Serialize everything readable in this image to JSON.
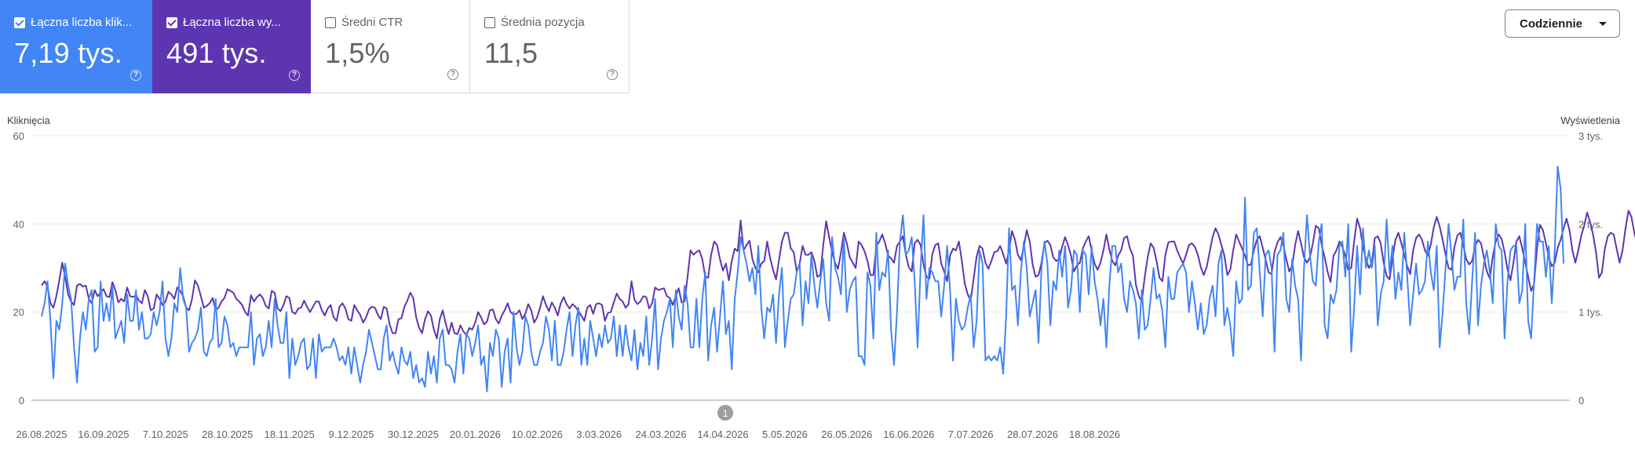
{
  "metrics": [
    {
      "label": "Łączna liczba klik...",
      "value": "7,19 tys.",
      "checked": true,
      "color": "#4285f4"
    },
    {
      "label": "Łączna liczba wy...",
      "value": "491 tys.",
      "checked": true,
      "color": "#5e35b1"
    },
    {
      "label": "Średni CTR",
      "value": "1,5%",
      "checked": false
    },
    {
      "label": "Średnia pozycja",
      "value": "11,5",
      "checked": false
    }
  ],
  "help_icon": "help-circle-icon",
  "period_dropdown": {
    "label": "Codziennie",
    "icon": "caret-down-icon"
  },
  "chart_data": {
    "type": "line",
    "left_axis_label": "Kliknięcia",
    "right_axis_label": "Wyświetlenia",
    "left_ticks": [
      "0",
      "20",
      "40",
      "60"
    ],
    "right_ticks": [
      "0",
      "1 tys.",
      "2 tys.",
      "3 tys."
    ],
    "left_ylim": [
      0,
      60
    ],
    "right_ylim": [
      0,
      3000
    ],
    "x_tick_labels": [
      "26.08.2025",
      "16.09.2025",
      "7.10.2025",
      "28.10.2025",
      "18.11.2025",
      "9.12.2025",
      "30.12.2025",
      "20.01.2026",
      "10.02.2026",
      "3.03.2026",
      "24.03.2026",
      "14.04.2026",
      "5.05.2026",
      "26.05.2026",
      "16.06.2026",
      "7.07.2026",
      "28.07.2026",
      "18.08.2026"
    ],
    "days_between_ticks": 21,
    "annotation": {
      "label": "1",
      "date": "14.04.2026"
    },
    "grid": true,
    "series": [
      {
        "name": "Kliknięcia",
        "axis": "left",
        "color": "#4285f4",
        "values": [
          19,
          22,
          27,
          18,
          5,
          18,
          16,
          22,
          31,
          26,
          23,
          12,
          4,
          14,
          20,
          16,
          23,
          25,
          11,
          12,
          27,
          18,
          22,
          18,
          26,
          14,
          16,
          18,
          13,
          24,
          18,
          18,
          25,
          16,
          20,
          14,
          14,
          15,
          20,
          17,
          20,
          27,
          14,
          10,
          14,
          22,
          20,
          30,
          23,
          21,
          11,
          13,
          14,
          16,
          21,
          11,
          10,
          13,
          14,
          23,
          12,
          13,
          19,
          17,
          12,
          13,
          10,
          12,
          12,
          12,
          12,
          20,
          8,
          14,
          15,
          10,
          12,
          18,
          12,
          23,
          17,
          13,
          13,
          20,
          5,
          14,
          8,
          10,
          13,
          14,
          7,
          8,
          14,
          5,
          15,
          11,
          12,
          12,
          12,
          14,
          12,
          9,
          10,
          8,
          12,
          6,
          12,
          8,
          4,
          8,
          11,
          16,
          13,
          10,
          7,
          7,
          14,
          17,
          9,
          11,
          8,
          6,
          12,
          9,
          8,
          11,
          5,
          8,
          4,
          5,
          3,
          11,
          6,
          10,
          4,
          14,
          16,
          8,
          8,
          7,
          4,
          11,
          15,
          6,
          15,
          14,
          10,
          13,
          17,
          8,
          10,
          2,
          13,
          10,
          16,
          14,
          3,
          11,
          14,
          4,
          20,
          12,
          8,
          11,
          19,
          17,
          11,
          8,
          8,
          11,
          13,
          19,
          16,
          9,
          18,
          8,
          8,
          11,
          16,
          20,
          10,
          17,
          21,
          8,
          14,
          8,
          18,
          14,
          10,
          15,
          12,
          17,
          13,
          14,
          19,
          10,
          17,
          10,
          17,
          12,
          9,
          16,
          7,
          13,
          10,
          19,
          8,
          14,
          23,
          7,
          14,
          18,
          20,
          23,
          12,
          25,
          19,
          16,
          26,
          22,
          12,
          12,
          23,
          12,
          23,
          29,
          9,
          17,
          21,
          11,
          19,
          27,
          15,
          18,
          7,
          23,
          29,
          37,
          34,
          31,
          27,
          30,
          24,
          35,
          21,
          14,
          21,
          20,
          24,
          13,
          24,
          30,
          12,
          18,
          23,
          24,
          29,
          31,
          17,
          27,
          22,
          33,
          26,
          21,
          27,
          32,
          22,
          18,
          37,
          30,
          28,
          24,
          37,
          20,
          25,
          27,
          28,
          10,
          10,
          8,
          29,
          26,
          14,
          38,
          25,
          29,
          28,
          34,
          16,
          8,
          20,
          36,
          42,
          33,
          34,
          37,
          27,
          12,
          30,
          42,
          23,
          30,
          29,
          27,
          27,
          19,
          26,
          35,
          25,
          9,
          23,
          18,
          16,
          17,
          21,
          24,
          12,
          18,
          34,
          31,
          9,
          10,
          9,
          10,
          9,
          12,
          6,
          19,
          39,
          25,
          26,
          17,
          29,
          36,
          30,
          19,
          22,
          25,
          13,
          30,
          36,
          31,
          17,
          27,
          25,
          34,
          28,
          35,
          21,
          25,
          34,
          33,
          20,
          34,
          33,
          24,
          35,
          27,
          23,
          17,
          23,
          12,
          26,
          35,
          35,
          29,
          31,
          23,
          20,
          27,
          25,
          22,
          14,
          25,
          16,
          17,
          23,
          30,
          23,
          24,
          20,
          12,
          28,
          23,
          23,
          29,
          30,
          31,
          29,
          20,
          27,
          22,
          16,
          22,
          15,
          17,
          23,
          26,
          19,
          31,
          34,
          17,
          21,
          17,
          10,
          27,
          22,
          23,
          46,
          25,
          26,
          38,
          39,
          29,
          19,
          33,
          34,
          30,
          11,
          33,
          34,
          38,
          23,
          20,
          32,
          26,
          23,
          9,
          30,
          42,
          33,
          27,
          26,
          36,
          40,
          17,
          14,
          24,
          22,
          25,
          35,
          36,
          28,
          40,
          11,
          21,
          35,
          24,
          39,
          30,
          34,
          30,
          35,
          17,
          24,
          27,
          41,
          29,
          35,
          23,
          29,
          25,
          38,
          28,
          17,
          24,
          31,
          24,
          25,
          27,
          36,
          29,
          25,
          35,
          12,
          20,
          30,
          40,
          33,
          25,
          28,
          28,
          41,
          22,
          15,
          27,
          38,
          17,
          26,
          31,
          34,
          29,
          22,
          40,
          35,
          34,
          14,
          27,
          34,
          35,
          35,
          22,
          25,
          40,
          18,
          14,
          27,
          40,
          36,
          36,
          28,
          35,
          22,
          34,
          53,
          48,
          31
        ]
      },
      {
        "name": "Wyświetlenia",
        "axis": "right",
        "color": "#5e35b1",
        "values": [
          1300,
          1350,
          1290,
          1100,
          1050,
          1180,
          1360,
          1560,
          1400,
          1200,
          1120,
          1080,
          1300,
          1320,
          1290,
          1300,
          1150,
          1100,
          1250,
          1180,
          1220,
          1260,
          1180,
          1170,
          1340,
          1250,
          1110,
          1150,
          1120,
          1280,
          1180,
          1170,
          1190,
          1130,
          1100,
          1250,
          1180,
          1020,
          1040,
          1200,
          1150,
          1080,
          1120,
          1230,
          1200,
          1150,
          1280,
          1240,
          1180,
          1050,
          1020,
          1150,
          1360,
          1300,
          1180,
          1050,
          1070,
          1100,
          1160,
          1020,
          1050,
          1120,
          1160,
          1260,
          1240,
          1220,
          1150,
          1120,
          1080,
          1000,
          960,
          1190,
          1120,
          1170,
          1200,
          1160,
          1070,
          1040,
          1240,
          1220,
          1040,
          1010,
          1080,
          1180,
          1160,
          1000,
          980,
          1040,
          1050,
          1130,
          1060,
          1000,
          1060,
          1120,
          1120,
          1020,
          960,
          1040,
          1080,
          940,
          900,
          1060,
          1100,
          1040,
          920,
          900,
          1080,
          1020,
          970,
          880,
          940,
          1030,
          1060,
          1050,
          970,
          920,
          1060,
          1040,
          860,
          760,
          760,
          920,
          930,
          1060,
          1130,
          1220,
          1160,
          940,
          820,
          760,
          920,
          1010,
          960,
          800,
          700,
          920,
          1020,
          870,
          750,
          880,
          760,
          750,
          850,
          780,
          740,
          820,
          800,
          880,
          1000,
          940,
          860,
          890,
          1020,
          1030,
          920,
          870,
          960,
          1020,
          1100,
          1000,
          970,
          980,
          1020,
          920,
          980,
          1090,
          1020,
          880,
          940,
          1050,
          1180,
          1080,
          1010,
          1110,
          1050,
          960,
          1100,
          1170,
          1090,
          1040,
          1090,
          1060,
          1010,
          960,
          900,
          1050,
          1080,
          980,
          1090,
          1100,
          1080,
          900,
          990,
          1000,
          1110,
          1210,
          1150,
          1120,
          1050,
          1090,
          1350,
          1140,
          1090,
          1120,
          1180,
          1170,
          1040,
          1100,
          1280,
          1250,
          1260,
          1270,
          1180,
          1160,
          1080,
          1180,
          1270,
          1110,
          1120,
          1400,
          1700,
          1650,
          1680,
          1700,
          1600,
          1400,
          1390,
          1650,
          1800,
          1760,
          1600,
          1470,
          1550,
          1360,
          1580,
          1720,
          1690,
          2040,
          1700,
          1760,
          1810,
          1600,
          1500,
          1450,
          1550,
          1580,
          1800,
          1610,
          1480,
          1370,
          1590,
          1800,
          1900,
          1900,
          1720,
          1680,
          1460,
          1550,
          1750,
          1650,
          1650,
          1680,
          1580,
          1400,
          1420,
          1760,
          2030,
          1850,
          1680,
          1560,
          1490,
          1670,
          1900,
          1780,
          1620,
          1560,
          1500,
          1800,
          1760,
          1690,
          1580,
          1420,
          1420,
          1750,
          1800,
          1880,
          1780,
          1640,
          1610,
          1560,
          1750,
          1800,
          1860,
          1650,
          1510,
          1460,
          1780,
          1820,
          1760,
          1540,
          1400,
          1380,
          1660,
          1760,
          1780,
          1550,
          1460,
          1350,
          1640,
          1720,
          1700,
          1800,
          1580,
          1320,
          1200,
          1130,
          1380,
          1630,
          1750,
          1720,
          1560,
          1490,
          1580,
          1680,
          1690,
          1750,
          1660,
          1550,
          1700,
          1920,
          1820,
          1650,
          1590,
          1740,
          1930,
          1800,
          1540,
          1400,
          1420,
          1560,
          1780,
          1810,
          1760,
          1620,
          1580,
          1600,
          1740,
          1850,
          1760,
          1640,
          1460,
          1530,
          1560,
          1720,
          1800,
          1860,
          1700,
          1550,
          1480,
          1560,
          1700,
          1880,
          1710,
          1580,
          1530,
          1640,
          1700,
          1840,
          1860,
          1720,
          1640,
          1310,
          1180,
          1120,
          1400,
          1620,
          1780,
          1730,
          1580,
          1390,
          1350,
          1650,
          1790,
          1800,
          1800,
          1700,
          1620,
          1550,
          1650,
          1760,
          1780,
          1740,
          1650,
          1510,
          1420,
          1510,
          1680,
          1850,
          1950,
          1880,
          1760,
          1640,
          1420,
          1480,
          1700,
          1880,
          1800,
          1720,
          1640,
          1530,
          1540,
          1700,
          1820,
          1860,
          1730,
          1590,
          1450,
          1430,
          1680,
          1790,
          1850,
          1760,
          1600,
          1460,
          1530,
          1760,
          1920,
          1780,
          1620,
          1560,
          1620,
          1780,
          1980,
          1950,
          1760,
          1620,
          1460,
          1340,
          1640,
          1700,
          1800,
          1740,
          1640,
          1480,
          1500,
          1800,
          2060,
          1950,
          1740,
          1600,
          1500,
          1560,
          1840,
          1860,
          1780,
          1560,
          1410,
          1370,
          1610,
          1820,
          1900,
          1780,
          1650,
          1520,
          1430,
          1700,
          1840,
          1880,
          1820,
          1700,
          1640,
          1770,
          1960,
          2080,
          1970,
          1820,
          1650,
          1500,
          1480,
          1740,
          1870,
          1900,
          1760,
          1600,
          1540,
          1580,
          1750,
          1820,
          1780,
          1620,
          1460,
          1380,
          1630,
          1800,
          1880,
          1830,
          1680,
          1480,
          1360,
          1560,
          1800,
          1860,
          1720,
          1560,
          1400,
          1240,
          1320,
          1720,
          1990,
          1930,
          1780,
          1620,
          1520,
          1560,
          1730,
          1820,
          1950,
          2060,
          1930,
          1700,
          1560,
          1700,
          1870,
          1980,
          2130,
          2020,
          1880,
          1680,
          1390,
          1450,
          1720,
          1860,
          1900,
          1880,
          1720,
          1560,
          1700,
          1950,
          2150,
          2080,
          1900,
          1760,
          1620,
          1700,
          1880,
          2060,
          2080,
          1950,
          1800,
          1650,
          2180,
          2050,
          1800,
          1690,
          1550,
          1660,
          1850,
          2000,
          2100,
          2050,
          1940,
          1740,
          1640,
          1650,
          1850,
          2050,
          2150,
          2080,
          1870,
          1730,
          1570,
          1650,
          1960,
          2100,
          2000,
          1820,
          1640,
          1500,
          1720,
          1880,
          2060,
          2050,
          1880,
          1720,
          2050,
          2650,
          2500,
          2420
        ]
      }
    ]
  }
}
